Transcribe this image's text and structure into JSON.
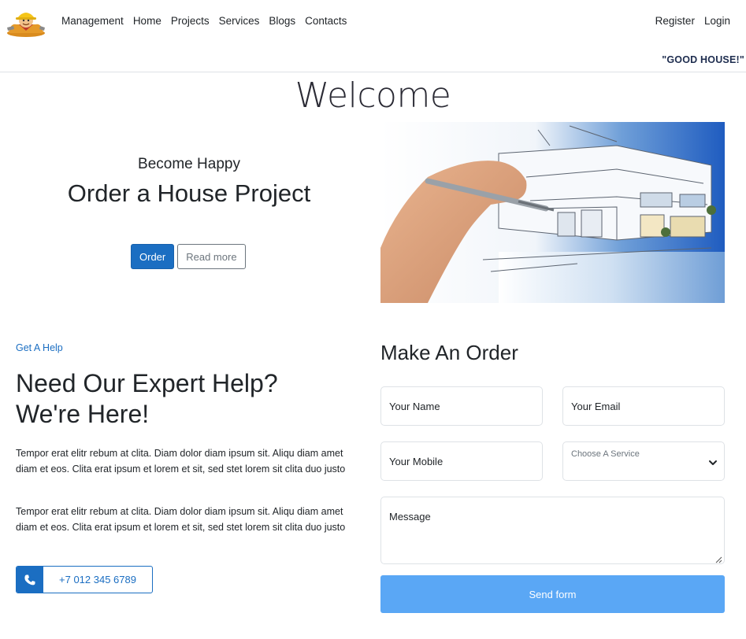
{
  "navbar": {
    "logo": {
      "icon": "builder-mascot-icon"
    },
    "links": [
      {
        "label": "Management"
      },
      {
        "label": "Home"
      },
      {
        "label": "Projects"
      },
      {
        "label": "Services"
      },
      {
        "label": "Blogs"
      },
      {
        "label": "Contacts"
      }
    ],
    "auth": [
      {
        "label": "Register"
      },
      {
        "label": "Login"
      }
    ],
    "slogan": "\"GOOD HOUSE!\""
  },
  "welcome": "Welcome",
  "hero": {
    "subtitle": "Become Happy",
    "title": "Order a House Project",
    "order_label": "Order",
    "read_more_label": "Read more",
    "image": "architect-sketching-modern-house"
  },
  "help": {
    "kicker": "Get A Help",
    "title_line1": "Need Our Expert Help?",
    "title_line2": "We're Here!",
    "paragraph1": "Tempor erat elitr rebum at clita. Diam dolor diam ipsum sit. Aliqu diam amet diam et eos. Clita erat ipsum et lorem et sit, sed stet lorem sit clita duo justo",
    "paragraph2": "Tempor erat elitr rebum at clita. Diam dolor diam ipsum sit. Aliqu diam amet diam et eos. Clita erat ipsum et lorem et sit, sed stet lorem sit clita duo justo",
    "phone": "+7 012 345 6789",
    "phone_icon": "phone-icon"
  },
  "order_form": {
    "title": "Make An Order",
    "name_placeholder": "Your Name",
    "email_placeholder": "Your Email",
    "mobile_placeholder": "Your Mobile",
    "service_label": "Choose A Service",
    "message_placeholder": "Message",
    "send_label": "Send form"
  },
  "colors": {
    "primary": "#1b6ec2",
    "send_button": "#5aa7f5",
    "slogan": "#1e2d4f"
  }
}
